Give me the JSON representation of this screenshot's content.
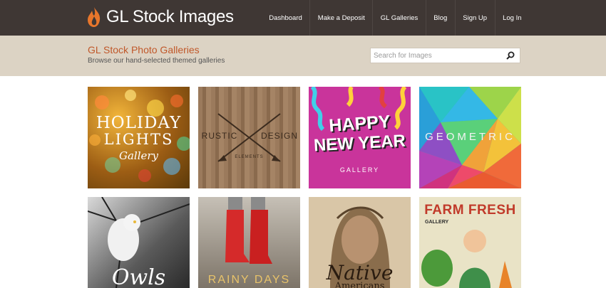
{
  "header": {
    "brand": "GL Stock Images",
    "nav": [
      "Dashboard",
      "Make a Deposit",
      "GL Galleries",
      "Blog",
      "Sign Up",
      "Log In"
    ]
  },
  "hero": {
    "title": "GL Stock Photo Galleries",
    "subtitle": "Browse our hand-selected themed galleries"
  },
  "search": {
    "placeholder": "Search for Images"
  },
  "galleries": [
    {
      "line1": "HOLIDAY",
      "line2": "LIGHTS",
      "line3": "Gallery"
    },
    {
      "line1": "RUSTIC",
      "line2": "DESIGN",
      "line3": "ELEMENTS"
    },
    {
      "line1": "HAPPY",
      "line2": "NEW YEAR",
      "line3": "GALLERY"
    },
    {
      "line1": "GEOMETRIC"
    },
    {
      "line1": "Owls"
    },
    {
      "line1": "RAINY DAYS"
    },
    {
      "line1": "Native",
      "line2": "Americans"
    },
    {
      "line1": "FARM FRESH",
      "line2": "GALLERY"
    }
  ],
  "colors": {
    "header": "#3f3734",
    "hero": "#dcd3c4",
    "accent": "#c0582a"
  }
}
